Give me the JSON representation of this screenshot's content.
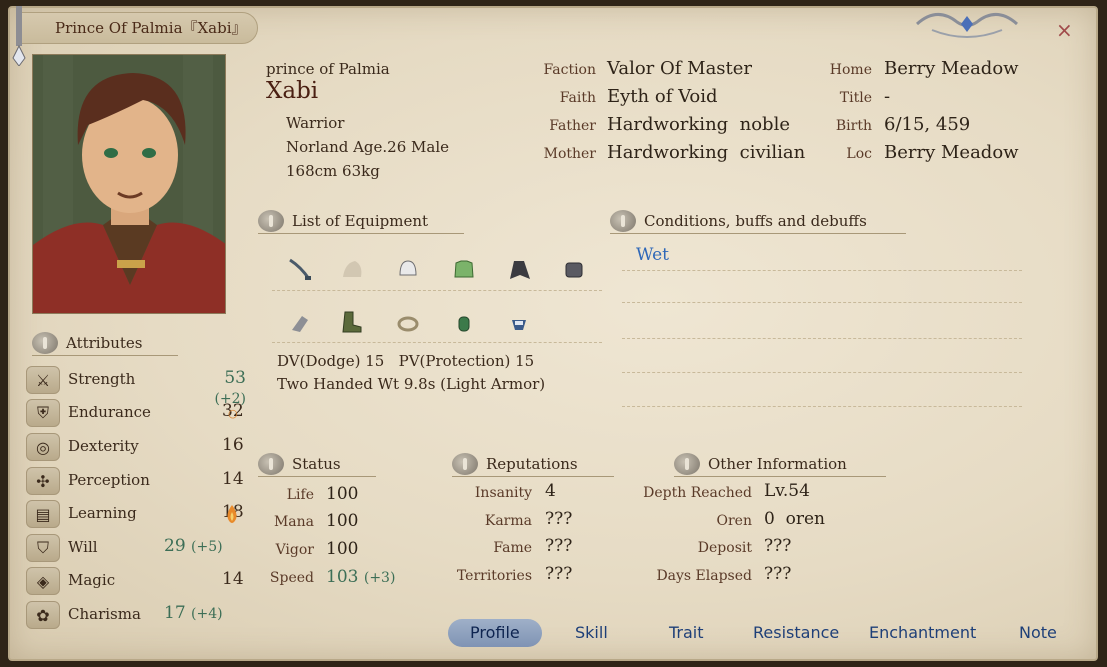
{
  "title": "Prince Of Palmia『Xabi』",
  "profile": {
    "alias": "prince of Palmia",
    "name": "Xabi",
    "class": "Warrior",
    "race_age_sex": "Norland Age.26 Male",
    "height_weight": "168cm 63kg"
  },
  "info_left": [
    {
      "label": "Faction",
      "value": "Valor Of Master"
    },
    {
      "label": "Faith",
      "value": "Eyth of Void"
    },
    {
      "label": "Father",
      "value": "Hardworking  noble"
    },
    {
      "label": "Mother",
      "value": "Hardworking  civilian"
    }
  ],
  "info_right": [
    {
      "label": "Home",
      "value": "Berry Meadow"
    },
    {
      "label": "Title",
      "value": "-"
    },
    {
      "label": "Birth",
      "value": "6/15, 459"
    },
    {
      "label": "Loc",
      "value": "Berry Meadow"
    }
  ],
  "equipment": {
    "heading": "List of Equipment",
    "row1_icons": [
      "sword-icon",
      "empty-slot-icon",
      "helmet-icon",
      "body-armor-icon",
      "cloak-icon",
      "gauntlet-icon"
    ],
    "row2_icons": [
      "girdle-icon",
      "boots-icon",
      "ring-icon",
      "amulet-icon",
      "ammo-icon"
    ],
    "dv_pv": "DV(Dodge) 15   PV(Protection) 15",
    "style": "Two Handed Wt 9.8s (Light Armor)"
  },
  "conditions": {
    "heading": "Conditions, buffs and debuffs",
    "items": [
      "Wet"
    ],
    "color": "#2f68b8"
  },
  "attributes": {
    "heading": "Attributes",
    "items": [
      {
        "name": "Strength",
        "value": "53",
        "bonus": "(+2)",
        "icon": "crossed-swords-icon",
        "highlight": true
      },
      {
        "name": "Endurance",
        "value": "32",
        "bonus": "",
        "icon": "armor-icon",
        "highlight": false,
        "marker": "○"
      },
      {
        "name": "Dexterity",
        "value": "16",
        "bonus": "",
        "icon": "target-icon",
        "highlight": false
      },
      {
        "name": "Perception",
        "value": "14",
        "bonus": "",
        "icon": "compass-icon",
        "highlight": false
      },
      {
        "name": "Learning",
        "value": "18",
        "bonus": "",
        "icon": "book-icon",
        "highlight": false,
        "marker": "flame"
      },
      {
        "name": "Will",
        "value": "29",
        "bonus": "(+5)",
        "icon": "shield-icon",
        "highlight": true
      },
      {
        "name": "Magic",
        "value": "14",
        "bonus": "",
        "icon": "rune-icon",
        "highlight": false
      },
      {
        "name": "Charisma",
        "value": "17",
        "bonus": "(+4)",
        "icon": "ribbon-icon",
        "highlight": true
      }
    ]
  },
  "status": {
    "heading": "Status",
    "items": [
      {
        "label": "Life",
        "value": "100",
        "bonus": ""
      },
      {
        "label": "Mana",
        "value": "100",
        "bonus": ""
      },
      {
        "label": "Vigor",
        "value": "100",
        "bonus": ""
      },
      {
        "label": "Speed",
        "value": "103",
        "bonus": "(+3)"
      }
    ]
  },
  "reputations": {
    "heading": "Reputations",
    "items": [
      {
        "label": "Insanity",
        "value": "4"
      },
      {
        "label": "Karma",
        "value": "???"
      },
      {
        "label": "Fame",
        "value": "???"
      },
      {
        "label": "Territories",
        "value": "???"
      }
    ]
  },
  "other": {
    "heading": "Other Information",
    "items": [
      {
        "label": "Depth Reached",
        "value": "Lv.54"
      },
      {
        "label": "Oren",
        "value": "0  oren"
      },
      {
        "label": "Deposit",
        "value": "???"
      },
      {
        "label": "Days Elapsed",
        "value": "???"
      }
    ]
  },
  "tabs": [
    "Profile",
    "Skill",
    "Trait",
    "Resistance",
    "Enchantment",
    "Note"
  ],
  "active_tab": "Profile",
  "close_label": "×"
}
